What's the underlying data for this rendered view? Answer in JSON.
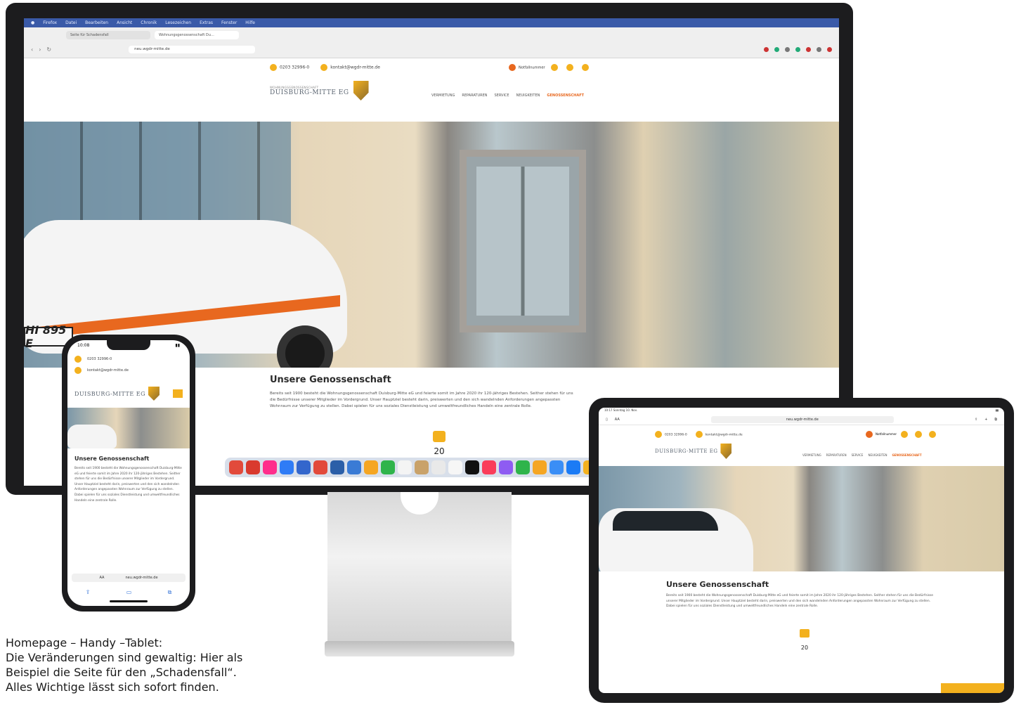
{
  "desktop": {
    "menubar": [
      "Firefox",
      "Datei",
      "Bearbeiten",
      "Ansicht",
      "Chronik",
      "Lesezeichen",
      "Extras",
      "Fenster",
      "Hilfe"
    ],
    "tabs": [
      "Seite für Schadensfall",
      "Wohnungsgenossenschaft Du…"
    ],
    "address": "neu.wgdr-mitte.de",
    "contact": {
      "phone": "0203 32996-0",
      "email": "kontakt@wgdr-mitte.de"
    },
    "quick_link": "Notfallnummer",
    "logo": {
      "line1": "WOHNUNGSGENOSSENSCHAFT",
      "line2": "DUISBURG-MITTE EG"
    },
    "nav": [
      "VERMIETUNG",
      "REPARATUREN",
      "SERVICE",
      "NEUIGKEITEN",
      "GENOSSENSCHAFT"
    ],
    "plate": "HI 895 E",
    "headline": "Unsere Genossenschaft",
    "body": "Bereits seit 1900 besteht die Wohnungsgenossenschaft Duisburg-Mitte eG und feierte somit im Jahre 2020 ihr 120-jähriges Bestehen. Seither stehen für uns die Bedürfnisse unserer Mitglieder im Vordergrund. Unser Hauptziel besteht darin, preiswerten und den sich wandelnden Anforderungen angepassten Wohnraum zur Verfügung zu stellen. Dabei spielen für uns soziales Dienstleistung und umweltfreundliches Handeln eine zentrale Rolle.",
    "page_number": "20"
  },
  "phone": {
    "time": "10:08",
    "contact_phone": "0203 32996-0",
    "contact_email": "kontakt@wgdr-mitte.de",
    "logo": "DUISBURG-MITTE EG",
    "headline": "Unsere Genossenschaft",
    "body": "Bereits seit 1900 besteht die Wohnungsgenossenschaft Duisburg-Mitte eG und feierte somit im Jahre 2020 ihr 120-jähriges Bestehen. Seither stehen für uns die Bedürfnisse unserer Mitglieder im Vordergrund. Unser Hauptziel besteht darin, preiswerten und den sich wandelnden Anforderungen angepassten Wohnraum zur Verfügung zu stellen. Dabei spielen für uns soziales Dienstleistung und umweltfreundliches Handeln eine zentrale Rolle.",
    "url_prefix": "AA",
    "url": "neu.wgdr-mitte.de"
  },
  "tablet": {
    "status_left": "10:17  Sonntag 10. Nov.",
    "url_prefix": "AA",
    "url": "neu.wgdr-mitte.de",
    "contact_phone": "0203 32996-0",
    "contact_email": "kontakt@wgdr-mitte.de",
    "quick_link": "Notfallnummer",
    "logo": "DUISBURG-MITTE EG",
    "nav": [
      "VERMIETUNG",
      "REPARATUREN",
      "SERVICE",
      "NEUIGKEITEN",
      "GENOSSENSCHAFT"
    ],
    "headline": "Unsere Genossenschaft",
    "body": "Bereits seit 1900 besteht die Wohnungsgenossenschaft Duisburg-Mitte eG und feierte somit im Jahre 2020 ihr 120-jähriges Bestehen. Seither stehen für uns die Bedürfnisse unserer Mitglieder im Vordergrund. Unser Hauptziel besteht darin, preiswerten und den sich wandelnden Anforderungen angepassten Wohnraum zur Verfügung zu stellen. Dabei spielen für uns soziales Dienstleistung und umweltfreundliches Handeln eine zentrale Rolle.",
    "page_number": "20"
  },
  "caption": {
    "line1": "Homepage – Handy –Tablet:",
    "line2": "Die Veränderungen sind gewaltig: Hier als",
    "line3": "Beispiel die Seite für den „Schadensfall“.",
    "line4": "Alles Wichtige lässt sich sofort finden."
  },
  "colors": {
    "accent_orange": "#e8681f",
    "accent_yellow": "#f3b11e"
  }
}
